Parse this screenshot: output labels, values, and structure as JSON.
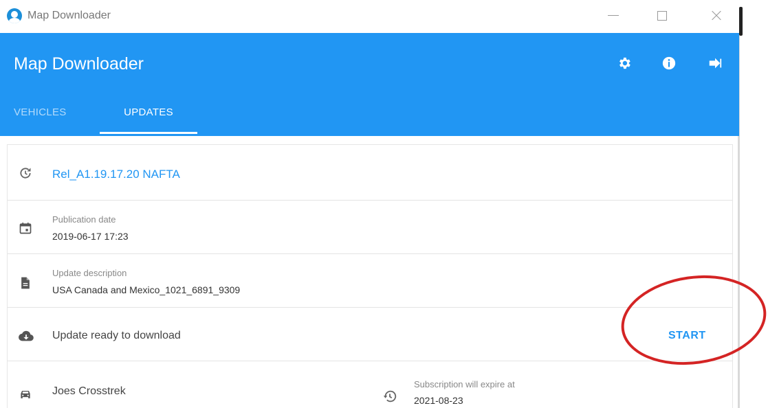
{
  "window": {
    "title": "Map Downloader"
  },
  "appbar": {
    "title": "Map Downloader",
    "color": "#2196f3"
  },
  "tabs": [
    {
      "label": "VEHICLES",
      "active": false
    },
    {
      "label": "UPDATES",
      "active": true
    }
  ],
  "release": {
    "name": "Rel_A1.19.17.20 NAFTA"
  },
  "publication": {
    "label": "Publication date",
    "value": "2019-06-17 17:23"
  },
  "description": {
    "label": "Update description",
    "value": "USA Canada and Mexico_1021_6891_9309"
  },
  "download": {
    "status": "Update ready to download",
    "action_label": "START"
  },
  "vehicle": {
    "name": "Joes Crosstrek",
    "subscription_label": "Subscription will expire at",
    "subscription_date": "2021-08-23"
  },
  "icons": {
    "release": "history-icon",
    "publication": "calendar-icon",
    "description": "document-icon",
    "download": "cloud-download-icon",
    "vehicle": "car-icon",
    "subscription": "restore-icon",
    "settings": "gear-icon",
    "info": "info-icon",
    "logout": "logout-icon"
  },
  "annotation_color": "#d42424"
}
